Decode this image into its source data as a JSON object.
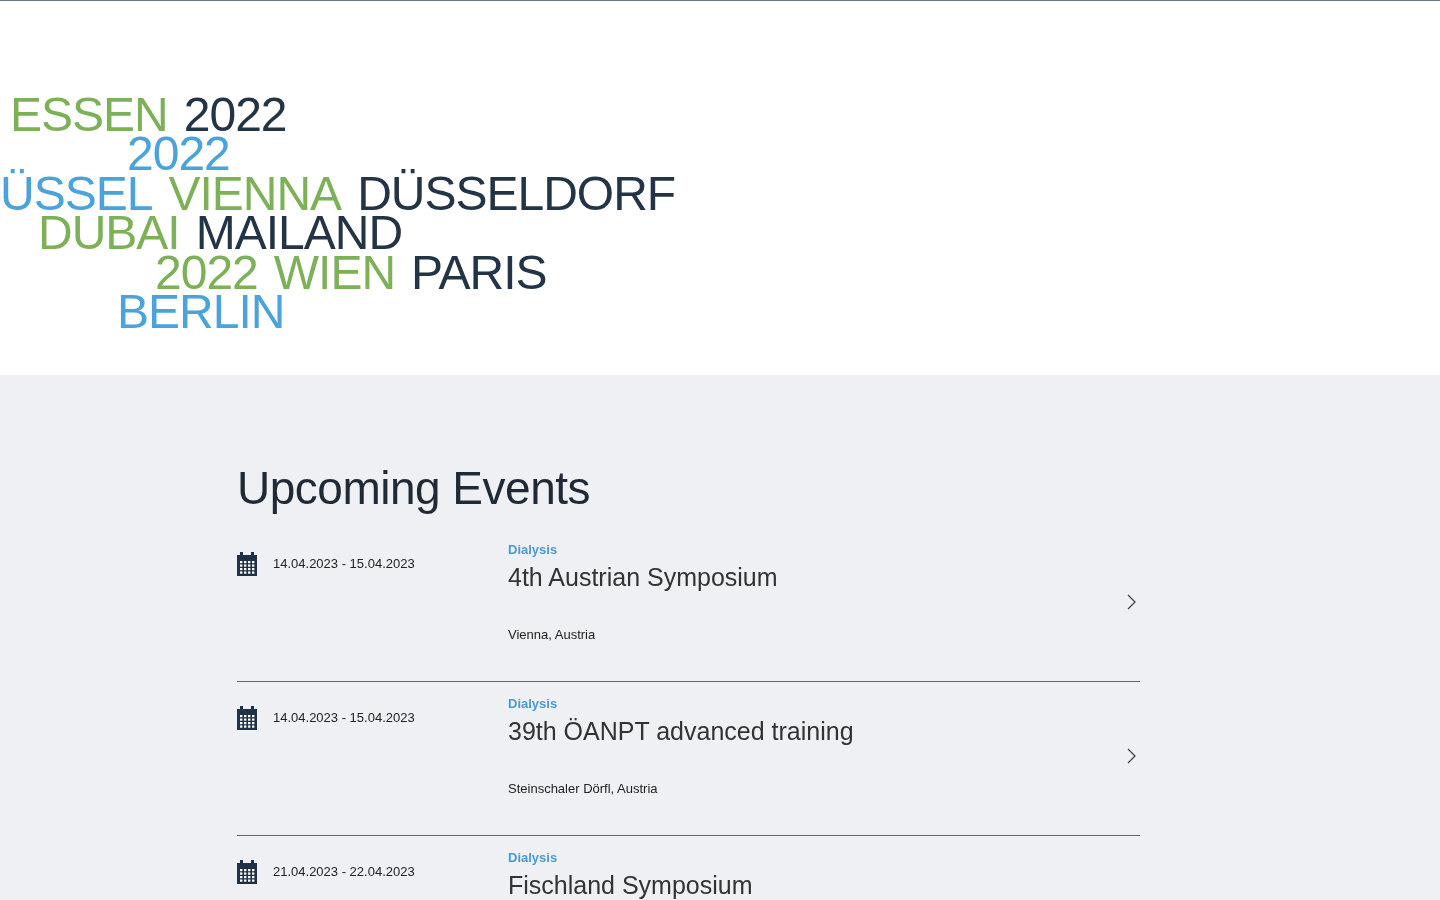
{
  "banner": {
    "rows": [
      {
        "words": [
          {
            "text": "ESSEN",
            "color": "#7db157"
          },
          {
            "text": "2022",
            "color": "#243447"
          }
        ]
      },
      {
        "words": [
          {
            "text": "2022",
            "color": "#4aa3dc"
          }
        ]
      },
      {
        "words": [
          {
            "text": "ÜSSEL",
            "color": "#4aa3dc"
          },
          {
            "text": "VIENNA",
            "color": "#7db157"
          },
          {
            "text": "DÜSSELDORF",
            "color": "#243447"
          }
        ]
      },
      {
        "words": [
          {
            "text": "DUBAI",
            "color": "#7db157"
          },
          {
            "text": "MAILAND",
            "color": "#243447"
          }
        ]
      },
      {
        "words": [
          {
            "text": "2022",
            "color": "#7db157"
          },
          {
            "text": "WIEN",
            "color": "#7db157"
          },
          {
            "text": "PARIS",
            "color": "#243447"
          }
        ]
      },
      {
        "words": [
          {
            "text": "BERLIN",
            "color": "#4aa3dc"
          }
        ]
      }
    ]
  },
  "events": {
    "title": "Upcoming Events",
    "items": [
      {
        "dates": "14.04.2023 - 15.04.2023",
        "category": "Dialysis",
        "name": "4th Austrian Symposium",
        "location": "Vienna, Austria"
      },
      {
        "dates": "14.04.2023 - 15.04.2023",
        "category": "Dialysis",
        "name": "39th ÖANPT advanced training",
        "location": "Steinschaler Dörfl, Austria"
      },
      {
        "dates": "21.04.2023 - 22.04.2023",
        "category": "Dialysis",
        "name": "Fischland Symposium"
      }
    ]
  }
}
